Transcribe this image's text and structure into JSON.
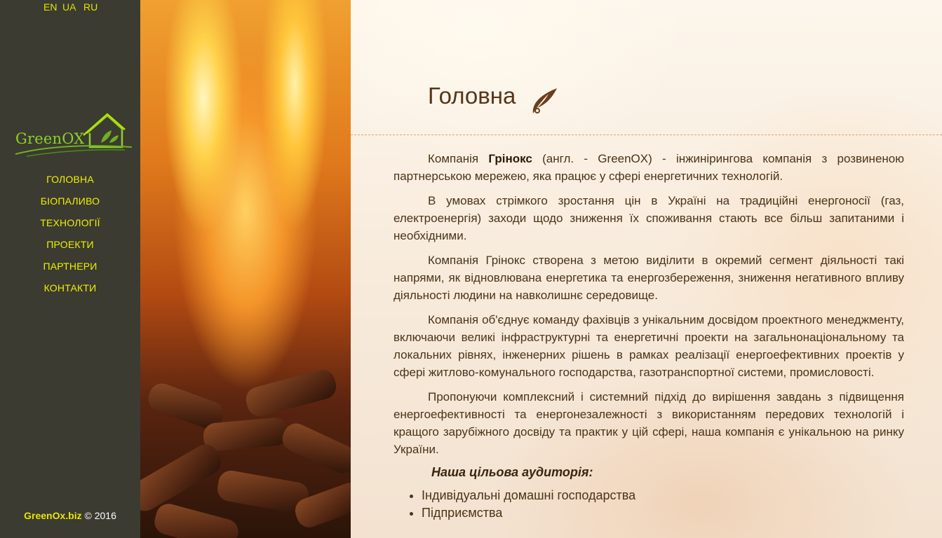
{
  "languages": [
    {
      "code": "EN",
      "active": false
    },
    {
      "code": "UA",
      "active": true
    },
    {
      "code": "RU",
      "active": false
    }
  ],
  "logo": {
    "text": "GreenOX"
  },
  "nav": {
    "items": [
      {
        "label": "ГОЛОВНА"
      },
      {
        "label": "БІОПАЛИВО"
      },
      {
        "label": "ТЕХНОЛОГІЇ"
      },
      {
        "label": "ПРОЕКТИ"
      },
      {
        "label": "ПАРТНЕРИ"
      },
      {
        "label": "КОНТАКТИ"
      }
    ]
  },
  "footer": {
    "site": "GreenOx.biz",
    "copyright": "© 2016"
  },
  "page": {
    "title": "Головна",
    "intro_prefix": "Компанія ",
    "intro_bold": "Грінокс",
    "intro_rest": " (англ. - GreenOX) - інжинірингова компанія з розвиненою партнерською мережею, яка працює у сфері енергетичних технологій.",
    "paragraphs": [
      "В умовах стрімкого зростання цін в Україні на традиційні енергоносії (газ, електроенергія) заходи щодо зниження їх споживання стають все більш запитаними і необхідними.",
      "Компанія Грінокс створена з метою виділити в окремий сегмент діяльності такі напрями, як відновлювана енергетика та енергозбереження, зниження негативного впливу діяльності людини на навколишнє середовище.",
      "Компанія об'єднує команду фахівців з унікальним досвідом проектного менеджменту, включаючи великі інфраструктурні та енергетичні проекти на загальнонаціональному та локальних рівнях, інженерних рішень в рамках реалізації енергоефективних проектів у сфері житлово-комунального господарства, газотранспортної системи, промисловості.",
      "Пропонуючи комплексний і системний підхід до вирішення завдань з підвищення енергоефективності та енергонезалежності з використанням передових технологій і кращого зарубіжного досвіду та практик у цій сфері, наша компанія є унікальною на ринку України."
    ],
    "audience_title": "Наша цільова аудиторія:",
    "audience": [
      "Індивідуальні домашні господарства",
      "Підприємства"
    ]
  },
  "colors": {
    "sidebar_bg": "#3b3b31",
    "nav_text": "#f0f000",
    "logo_green": "#8fcf2a",
    "title_brown": "#5a3418"
  }
}
